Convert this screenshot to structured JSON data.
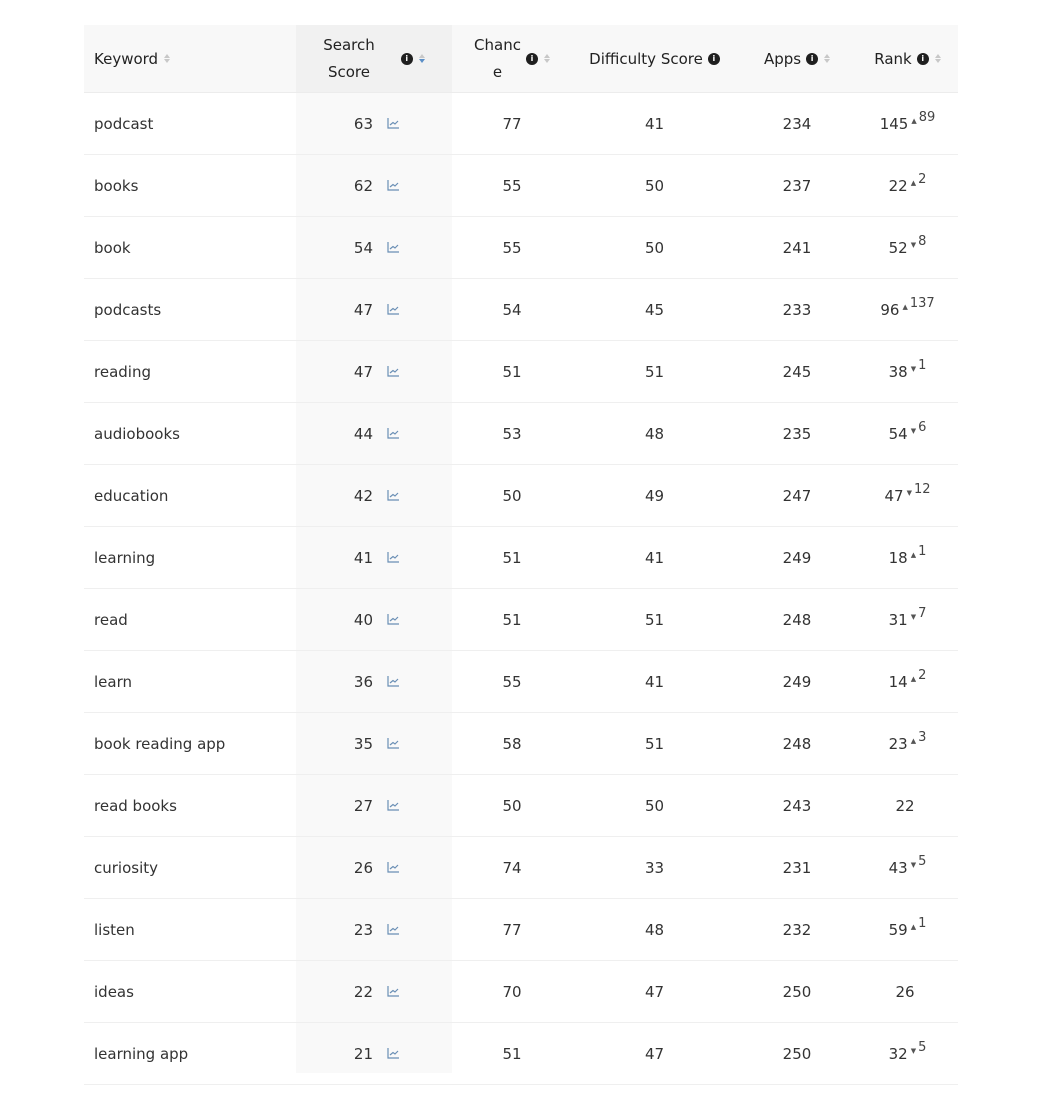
{
  "columns": {
    "keyword": "Keyword",
    "search_score_line1": "Search",
    "search_score_line2": "Score",
    "chance_line1": "Chanc",
    "chance_line2": "e",
    "difficulty": "Difficulty Score",
    "apps": "Apps",
    "rank": "Rank"
  },
  "icons": {
    "info": "info-icon",
    "sort": "sort-icon",
    "trend": "trend-chart-icon",
    "up": "▲",
    "down": "▼"
  },
  "colors": {
    "sort_active": "#5b8fc7",
    "trend_icon": "#6a8fb5"
  },
  "rows": [
    {
      "keyword": "podcast",
      "search_score": "63",
      "chance": "77",
      "difficulty": "41",
      "apps": "234",
      "rank": "145",
      "dir": "up",
      "delta": "89"
    },
    {
      "keyword": "books",
      "search_score": "62",
      "chance": "55",
      "difficulty": "50",
      "apps": "237",
      "rank": "22",
      "dir": "up",
      "delta": "2"
    },
    {
      "keyword": "book",
      "search_score": "54",
      "chance": "55",
      "difficulty": "50",
      "apps": "241",
      "rank": "52",
      "dir": "down",
      "delta": "8"
    },
    {
      "keyword": "podcasts",
      "search_score": "47",
      "chance": "54",
      "difficulty": "45",
      "apps": "233",
      "rank": "96",
      "dir": "up",
      "delta": "137"
    },
    {
      "keyword": "reading",
      "search_score": "47",
      "chance": "51",
      "difficulty": "51",
      "apps": "245",
      "rank": "38",
      "dir": "down",
      "delta": "1"
    },
    {
      "keyword": "audiobooks",
      "search_score": "44",
      "chance": "53",
      "difficulty": "48",
      "apps": "235",
      "rank": "54",
      "dir": "down",
      "delta": "6"
    },
    {
      "keyword": "education",
      "search_score": "42",
      "chance": "50",
      "difficulty": "49",
      "apps": "247",
      "rank": "47",
      "dir": "down",
      "delta": "12"
    },
    {
      "keyword": "learning",
      "search_score": "41",
      "chance": "51",
      "difficulty": "41",
      "apps": "249",
      "rank": "18",
      "dir": "up",
      "delta": "1"
    },
    {
      "keyword": "read",
      "search_score": "40",
      "chance": "51",
      "difficulty": "51",
      "apps": "248",
      "rank": "31",
      "dir": "down",
      "delta": "7"
    },
    {
      "keyword": "learn",
      "search_score": "36",
      "chance": "55",
      "difficulty": "41",
      "apps": "249",
      "rank": "14",
      "dir": "up",
      "delta": "2"
    },
    {
      "keyword": "book reading app",
      "search_score": "35",
      "chance": "58",
      "difficulty": "51",
      "apps": "248",
      "rank": "23",
      "dir": "up",
      "delta": "3"
    },
    {
      "keyword": "read books",
      "search_score": "27",
      "chance": "50",
      "difficulty": "50",
      "apps": "243",
      "rank": "22",
      "dir": "",
      "delta": ""
    },
    {
      "keyword": "curiosity",
      "search_score": "26",
      "chance": "74",
      "difficulty": "33",
      "apps": "231",
      "rank": "43",
      "dir": "down",
      "delta": "5"
    },
    {
      "keyword": "listen",
      "search_score": "23",
      "chance": "77",
      "difficulty": "48",
      "apps": "232",
      "rank": "59",
      "dir": "up",
      "delta": "1"
    },
    {
      "keyword": "ideas",
      "search_score": "22",
      "chance": "70",
      "difficulty": "47",
      "apps": "250",
      "rank": "26",
      "dir": "",
      "delta": ""
    },
    {
      "keyword": "learning app",
      "search_score": "21",
      "chance": "51",
      "difficulty": "47",
      "apps": "250",
      "rank": "32",
      "dir": "down",
      "delta": "5"
    }
  ]
}
